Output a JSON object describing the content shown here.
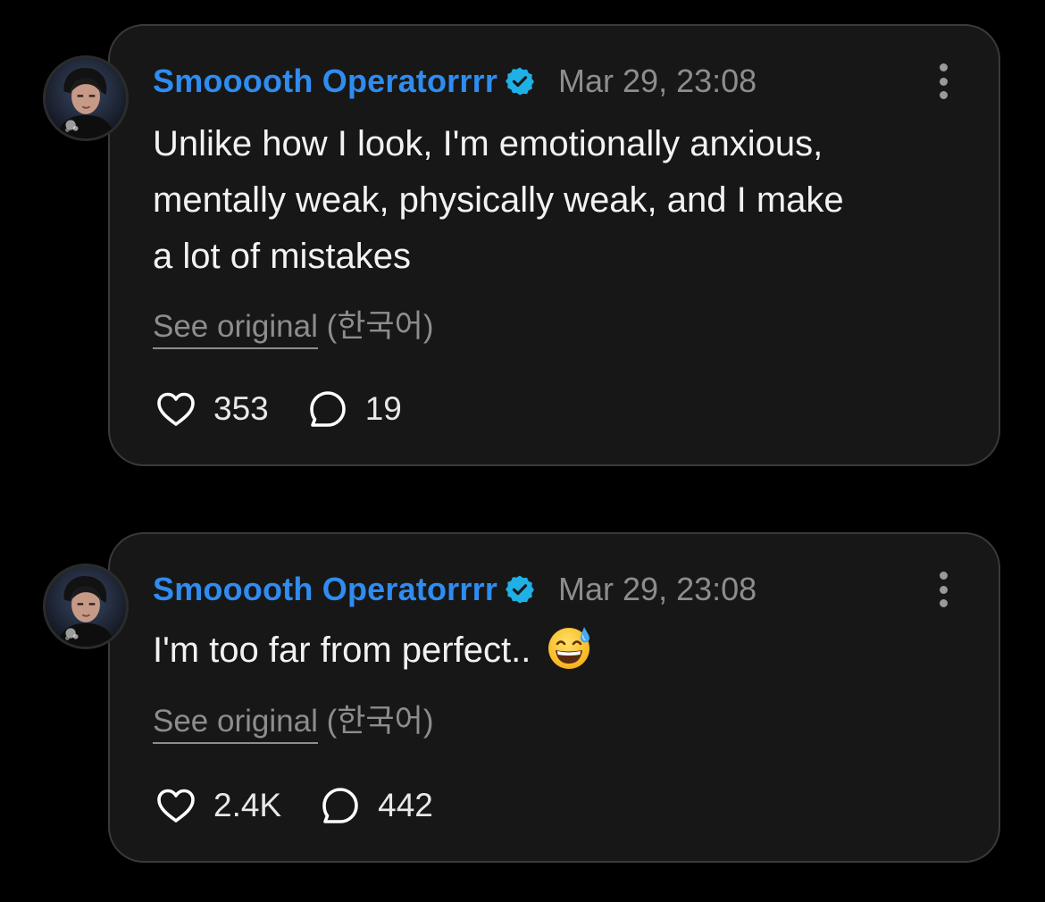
{
  "posts": [
    {
      "author": "Smooooth Operatorrrr",
      "timestamp": "Mar 29, 23:08",
      "lines": [
        "Unlike how I look, I'm emotionally anxious,",
        "mentally weak, physically weak, and I make",
        "a lot of mistakes"
      ],
      "see_original": "See original",
      "language": "(한국어)",
      "likes": "353",
      "replies": "19"
    },
    {
      "author": "Smooooth Operatorrrr",
      "timestamp": "Mar 29, 23:08",
      "text": "I'm too far from perfect..",
      "emoji": "😅",
      "see_original": "See original",
      "language": "(한국어)",
      "likes": "2.4K",
      "replies": "442"
    }
  ],
  "icons": {
    "verified": "verified-badge-icon",
    "more": "more-vertical-icon",
    "like": "heart-icon",
    "reply": "speech-bubble-icon",
    "emoji": "grinning-face-with-sweat-emoji"
  },
  "colors": {
    "background": "#000000",
    "card": "#171717",
    "card_border": "#3a3a3a",
    "username": "#2f8cf0",
    "verified": "#1fb0e6",
    "muted": "#8d8d8d",
    "text": "#f2f2f2"
  }
}
